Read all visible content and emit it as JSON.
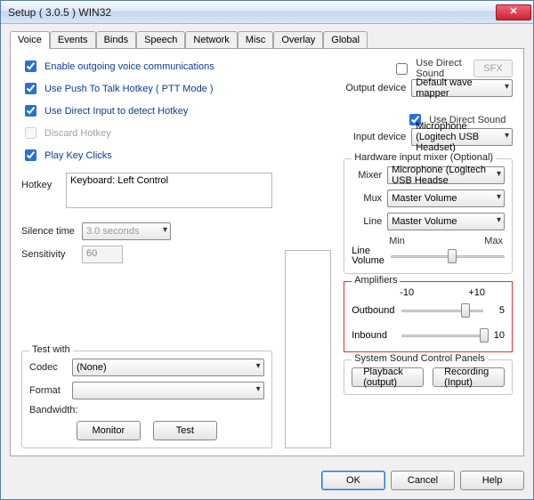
{
  "title": "Setup ( 3.0.5 ) WIN32",
  "tabs": [
    "Voice",
    "Events",
    "Binds",
    "Speech",
    "Network",
    "Misc",
    "Overlay",
    "Global"
  ],
  "left": {
    "enable_outgoing": "Enable outgoing voice communications",
    "use_ptt": "Use Push To Talk Hotkey ( PTT Mode )",
    "use_directinput": "Use Direct Input to detect Hotkey",
    "discard": "Discard Hotkey",
    "play_clicks": "Play Key Clicks",
    "hotkey_lbl": "Hotkey",
    "hotkey_val": "Keyboard: Left Control",
    "silence_lbl": "Silence time",
    "silence_val": "3.0 seconds",
    "sensitivity_lbl": "Sensitivity",
    "sensitivity_val": "60",
    "test_legend": "Test with",
    "codec_lbl": "Codec",
    "codec_val": "(None)",
    "format_lbl": "Format",
    "format_val": "",
    "bandwidth_lbl": "Bandwidth:",
    "monitor": "Monitor",
    "test": "Test"
  },
  "right": {
    "use_ds_out": "Use Direct Sound",
    "sfx": "SFX",
    "out_lbl": "Output device",
    "out_val": "Default wave mapper",
    "use_ds_in": "Use Direct Sound",
    "in_lbl": "Input device",
    "in_val": "Microphone (Logitech USB Headset)",
    "hw_legend": "Hardware input mixer (Optional)",
    "mixer_lbl": "Mixer",
    "mixer_val": "Microphone (Logitech USB Headse",
    "mux_lbl": "Mux",
    "mux_val": "Master Volume",
    "line_lbl": "Line",
    "line_val": "Master Volume",
    "min": "Min",
    "max": "Max",
    "linevol_lbl": "Line Volume",
    "amp_legend": "Amplifiers",
    "amp_lo": "-10",
    "amp_hi": "+10",
    "outbound_lbl": "Outbound",
    "outbound_val": "5",
    "inbound_lbl": "Inbound",
    "inbound_val": "10",
    "syspanels_legend": "System Sound Control Panels",
    "playback": "Playback (output)",
    "recording": "Recording (Input)"
  },
  "buttons": {
    "ok": "OK",
    "cancel": "Cancel",
    "help": "Help"
  }
}
